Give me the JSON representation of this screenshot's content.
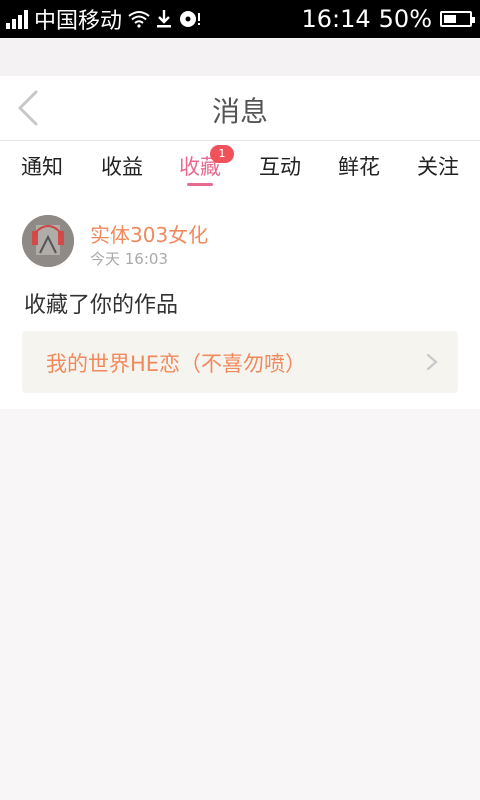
{
  "status_bar": {
    "carrier": "中国移动",
    "time": "16:14",
    "battery": "50%",
    "battery_level": 0.5
  },
  "header": {
    "title": "消息"
  },
  "tabs": [
    {
      "label": "通知"
    },
    {
      "label": "收益"
    },
    {
      "label": "收藏",
      "active": true,
      "badge": "1"
    },
    {
      "label": "互动"
    },
    {
      "label": "鲜花"
    },
    {
      "label": "关注"
    }
  ],
  "message": {
    "username": "实体303女化",
    "time": "今天 16:03",
    "action": "收藏了你的作品",
    "work_title": "我的世界HE恋（不喜勿喷）"
  },
  "colors": {
    "accent": "#e86b8f",
    "orange": "#f08a5d",
    "badge": "#f0525b"
  }
}
